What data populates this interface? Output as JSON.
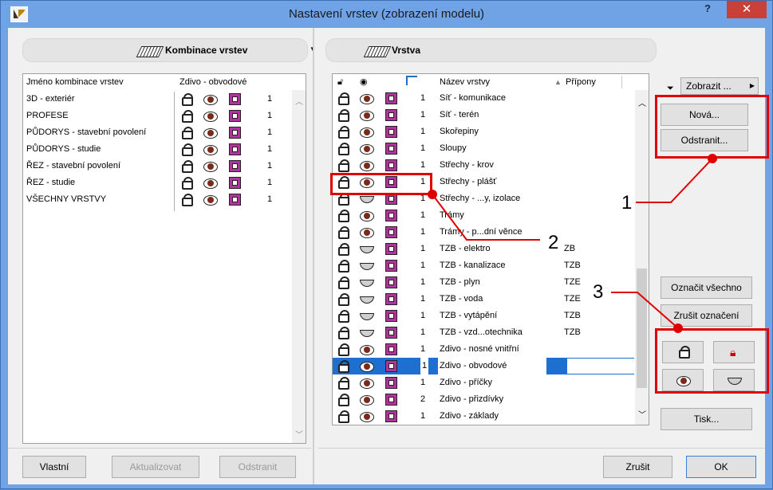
{
  "window": {
    "title": "Nastavení vrstev (zobrazení modelu)",
    "help": "?",
    "close": "✕"
  },
  "left": {
    "header": "Kombinace vrstev",
    "columns": {
      "name": "Jméno kombinace vrstev",
      "wall": "Zdivo - obvodové"
    },
    "rows": [
      {
        "name": "3D - exteriér",
        "num": "1"
      },
      {
        "name": "PROFESE",
        "num": "1"
      },
      {
        "name": "PŮDORYS - stavební povolení",
        "num": "1"
      },
      {
        "name": "PŮDORYS - studie",
        "num": "1"
      },
      {
        "name": "ŘEZ - stavební povolení",
        "num": "1"
      },
      {
        "name": "ŘEZ - studie",
        "num": "1"
      },
      {
        "name": "VŠECHNY VRSTVY",
        "num": "1"
      }
    ],
    "buttons": {
      "custom": "Vlastní",
      "update": "Aktualizovat",
      "remove": "Odstranit"
    }
  },
  "right": {
    "header": "Vrstva",
    "columns": {
      "name": "Název vrstvy",
      "ext": "Přípony"
    },
    "filter_label": "Zobrazit ...",
    "rows": [
      {
        "name": "Síť - komunikace",
        "num": "1",
        "ext": "",
        "eye": "open"
      },
      {
        "name": "Síť - terén",
        "num": "1",
        "ext": "",
        "eye": "open"
      },
      {
        "name": "Skořepiny",
        "num": "1",
        "ext": "",
        "eye": "open"
      },
      {
        "name": "Sloupy",
        "num": "1",
        "ext": "",
        "eye": "open"
      },
      {
        "name": "Střechy - krov",
        "num": "1",
        "ext": "",
        "eye": "open"
      },
      {
        "name": "Střechy - plášť",
        "num": "1",
        "ext": "",
        "eye": "open"
      },
      {
        "name": "Střechy - ...y, izolace",
        "num": "1",
        "ext": "",
        "eye": "closed"
      },
      {
        "name": "Trámy",
        "num": "1",
        "ext": "",
        "eye": "open"
      },
      {
        "name": "Trámy - p...dní věnce",
        "num": "1",
        "ext": "",
        "eye": "open"
      },
      {
        "name": "TZB - elektro",
        "num": "1",
        "ext": "ZB",
        "eye": "closed"
      },
      {
        "name": "TZB - kanalizace",
        "num": "1",
        "ext": "TZB",
        "eye": "closed"
      },
      {
        "name": "TZB - plyn",
        "num": "1",
        "ext": "TZE",
        "eye": "closed"
      },
      {
        "name": "TZB - voda",
        "num": "1",
        "ext": "TZE",
        "eye": "closed"
      },
      {
        "name": "TZB - vytápění",
        "num": "1",
        "ext": "TZB",
        "eye": "closed"
      },
      {
        "name": "TZB - vzd...otechnika",
        "num": "1",
        "ext": "TZB",
        "eye": "closed"
      },
      {
        "name": "Zdivo - nosné vnitřní",
        "num": "1",
        "ext": "",
        "eye": "open"
      },
      {
        "name": "Zdivo - obvodové",
        "num": "1",
        "ext": "",
        "eye": "open",
        "selected": true
      },
      {
        "name": "Zdivo - příčky",
        "num": "1",
        "ext": "",
        "eye": "open"
      },
      {
        "name": "Zdivo - přizdívky",
        "num": "2",
        "ext": "",
        "eye": "open"
      },
      {
        "name": "Zdivo - základy",
        "num": "1",
        "ext": "",
        "eye": "open"
      }
    ],
    "buttons": {
      "new": "Nová...",
      "remove": "Odstranit...",
      "select_all": "Označit všechno",
      "deselect": "Zrušit označení",
      "print": "Tisk...",
      "cancel": "Zrušit",
      "ok": "OK"
    }
  },
  "callouts": {
    "one": "1",
    "two": "2",
    "three": "3"
  },
  "colors": {
    "titlebar": "#6fa3e6",
    "close": "#c9403a",
    "selection": "#1e6fd0",
    "callout": "#e00000"
  }
}
